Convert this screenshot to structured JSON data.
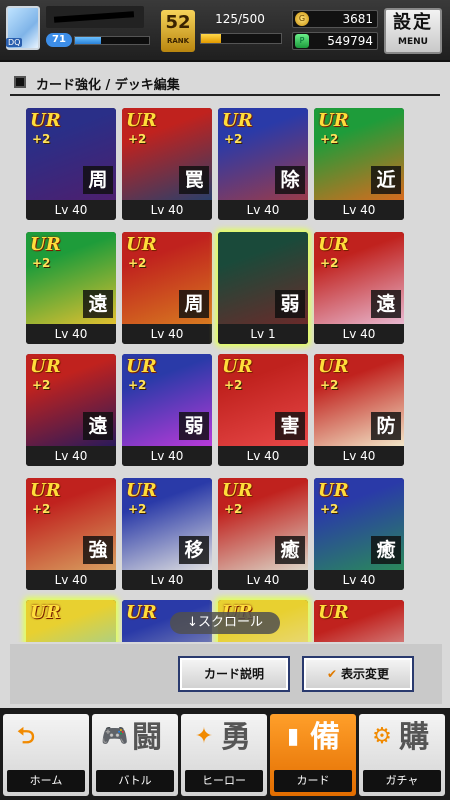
{
  "header": {
    "avatar_level": "DQ",
    "player_level": "71",
    "exp_fraction": 0.35,
    "rank_number": "52",
    "rank_label": "RANK",
    "stamina": "125/500",
    "stamina_fraction": 0.25,
    "coins": "3681",
    "gems": "549794",
    "settings_label": "設定",
    "menu_label": "MENU"
  },
  "section": {
    "title": "カード強化 / デッキ編集"
  },
  "cards": [
    {
      "rarity": "UR",
      "plus": "+2",
      "role": "周",
      "level": "Lv 40",
      "colors": [
        "#2a2f88",
        "#4d1f6e"
      ],
      "glow": false
    },
    {
      "rarity": "UR",
      "plus": "+2",
      "role": "罠",
      "level": "Lv 40",
      "colors": [
        "#c0221e",
        "#2a3f6a"
      ],
      "glow": false
    },
    {
      "rarity": "UR",
      "plus": "+2",
      "role": "除",
      "level": "Lv 40",
      "colors": [
        "#2a3aa8",
        "#9a3b4a"
      ],
      "glow": false
    },
    {
      "rarity": "UR",
      "plus": "+2",
      "role": "近",
      "level": "Lv 40",
      "colors": [
        "#1e9c3a",
        "#d86b1e"
      ],
      "glow": false
    },
    {
      "rarity": "UR",
      "plus": "+2",
      "role": "遠",
      "level": "Lv 40",
      "colors": [
        "#1e9c3a",
        "#e2c030"
      ],
      "glow": false
    },
    {
      "rarity": "UR",
      "plus": "+2",
      "role": "周",
      "level": "Lv 40",
      "colors": [
        "#c0221e",
        "#d87a20"
      ],
      "glow": false
    },
    {
      "rarity": "",
      "plus": "",
      "role": "弱",
      "level": "Lv 1",
      "colors": [
        "#1a4a3a",
        "#6a2a2a"
      ],
      "glow": true
    },
    {
      "rarity": "UR",
      "plus": "+2",
      "role": "遠",
      "level": "Lv 40",
      "colors": [
        "#c0221e",
        "#e8b8d0"
      ],
      "glow": false
    },
    {
      "rarity": "UR",
      "plus": "+2",
      "role": "遠",
      "level": "Lv 40",
      "colors": [
        "#c0221e",
        "#2a1a5a"
      ],
      "glow": false
    },
    {
      "rarity": "UR",
      "plus": "+2",
      "role": "弱",
      "level": "Lv 40",
      "colors": [
        "#2a3aa8",
        "#b83ad8"
      ],
      "glow": false
    },
    {
      "rarity": "UR",
      "plus": "+2",
      "role": "害",
      "level": "Lv 40",
      "colors": [
        "#c0221e",
        "#e84848"
      ],
      "glow": false
    },
    {
      "rarity": "UR",
      "plus": "+2",
      "role": "防",
      "level": "Lv 40",
      "colors": [
        "#c0221e",
        "#f2e6c8"
      ],
      "glow": false
    },
    {
      "rarity": "UR",
      "plus": "+2",
      "role": "強",
      "level": "Lv 40",
      "colors": [
        "#c0221e",
        "#d8a060"
      ],
      "glow": false
    },
    {
      "rarity": "UR",
      "plus": "+2",
      "role": "移",
      "level": "Lv 40",
      "colors": [
        "#2a3aa8",
        "#e0e0e0"
      ],
      "glow": false
    },
    {
      "rarity": "UR",
      "plus": "+2",
      "role": "癒",
      "level": "Lv 40",
      "colors": [
        "#c0221e",
        "#dcd6c8"
      ],
      "glow": false
    },
    {
      "rarity": "UR",
      "plus": "+2",
      "role": "癒",
      "level": "Lv 40",
      "colors": [
        "#2a3aa8",
        "#2a8a5a"
      ],
      "glow": false
    },
    {
      "rarity": "UR",
      "plus": "",
      "role": "",
      "level": "",
      "colors": [
        "#e8d030",
        "#6ad0e0"
      ],
      "glow": true
    },
    {
      "rarity": "UR",
      "plus": "",
      "role": "",
      "level": "",
      "colors": [
        "#2a3aa8",
        "#c0c0c0"
      ],
      "glow": false
    },
    {
      "rarity": "UR",
      "plus": "",
      "role": "",
      "level": "",
      "colors": [
        "#e8d030",
        "#e8e0c0"
      ],
      "glow": true
    },
    {
      "rarity": "UR",
      "plus": "",
      "role": "",
      "level": "",
      "colors": [
        "#c0221e",
        "#e8e0e0"
      ],
      "glow": false
    }
  ],
  "scroll_hint": "↓スクロール",
  "actions": {
    "card_description": "カード説明",
    "view_toggle": "表示変更"
  },
  "nav": [
    {
      "label": "ホーム",
      "kanji": "",
      "icon": "back-arrow-icon",
      "glyph": "⮌",
      "active": false
    },
    {
      "label": "バトル",
      "kanji": "闘",
      "icon": "gamepad-icon",
      "glyph": "🎮",
      "active": false
    },
    {
      "label": "ヒーロー",
      "kanji": "勇",
      "icon": "hero-icon",
      "glyph": "✦",
      "active": false
    },
    {
      "label": "カード",
      "kanji": "備",
      "icon": "cards-icon",
      "glyph": "▮",
      "active": true
    },
    {
      "label": "ガチャ",
      "kanji": "購",
      "icon": "gacha-icon",
      "glyph": "⚙",
      "active": false
    }
  ]
}
